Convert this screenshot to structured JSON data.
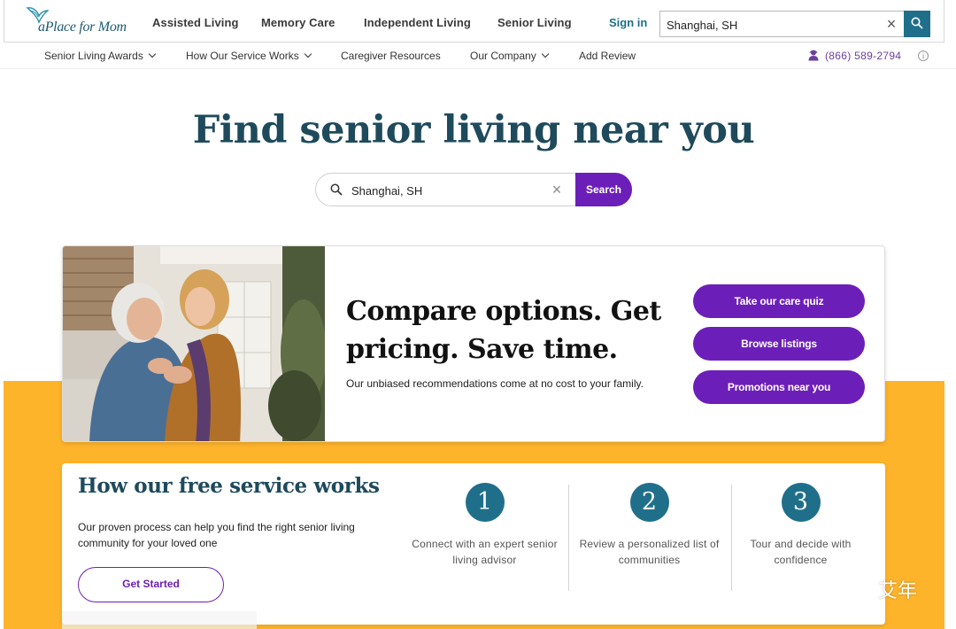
{
  "brand": {
    "logo_text": "aPlace for Mom"
  },
  "header": {
    "nav": [
      "Assisted Living",
      "Memory Care",
      "Independent Living",
      "Senior Living"
    ],
    "sign_in": "Sign in",
    "search_value": "Shanghai, SH"
  },
  "subnav": {
    "items": [
      "Senior Living Awards",
      "How Our Service Works",
      "Caregiver Resources",
      "Our Company",
      "Add Review"
    ],
    "phone": "(866) 589-2794"
  },
  "hero": {
    "title": "Find senior living near you",
    "search_value": "Shanghai, SH",
    "search_button": "Search"
  },
  "compare": {
    "title": "Compare options. Get pricing. Save time.",
    "description": "Our unbiased recommendations come at no cost to your family.",
    "buttons": [
      "Take our care quiz",
      "Browse listings",
      "Promotions near you"
    ]
  },
  "how": {
    "title": "How our free service works",
    "description": "Our proven process can help you find the right senior living community for your loved one",
    "cta": "Get Started",
    "steps": [
      {
        "number": "1",
        "text": "Connect with an expert senior living advisor"
      },
      {
        "number": "2",
        "text": "Review a personalized list of communities"
      },
      {
        "number": "3",
        "text": "Tour and decide with confidence"
      }
    ]
  },
  "watermark": {
    "text": "艾年"
  },
  "colors": {
    "primary_purple": "#6c1fb8",
    "teal": "#1f6f8b",
    "heading_navy": "#1e4a5c",
    "band_yellow": "#fdb32a"
  }
}
